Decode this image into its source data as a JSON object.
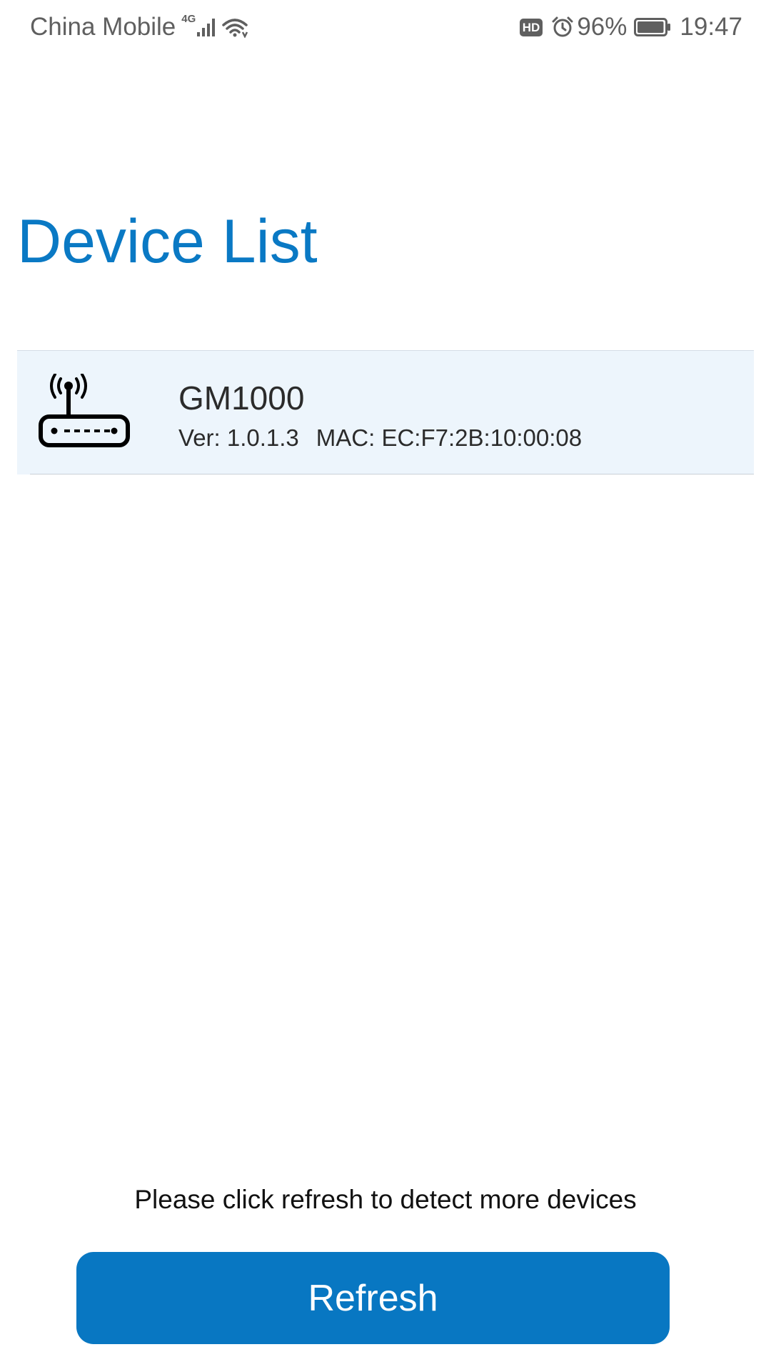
{
  "status_bar": {
    "carrier": "China Mobile",
    "network_type": "4G",
    "hd_badge": "HD",
    "battery_percent": "96%",
    "battery_level": 0.96,
    "time": "19:47",
    "icons": [
      "signal-bars-icon",
      "wifi-icon",
      "alarm-clock-icon",
      "battery-icon"
    ]
  },
  "page": {
    "title": "Device List"
  },
  "devices": [
    {
      "name": "GM1000",
      "version_text": "Ver: 1.0.1.3",
      "mac_text": "MAC: EC:F7:2B:10:00:08",
      "icon": "router-icon"
    }
  ],
  "footer": {
    "hint": "Please click refresh to detect more devices",
    "refresh_label": "Refresh"
  },
  "colors": {
    "accent": "#0a79c4",
    "button": "#0877c2",
    "item_background": "#edf5fc"
  }
}
